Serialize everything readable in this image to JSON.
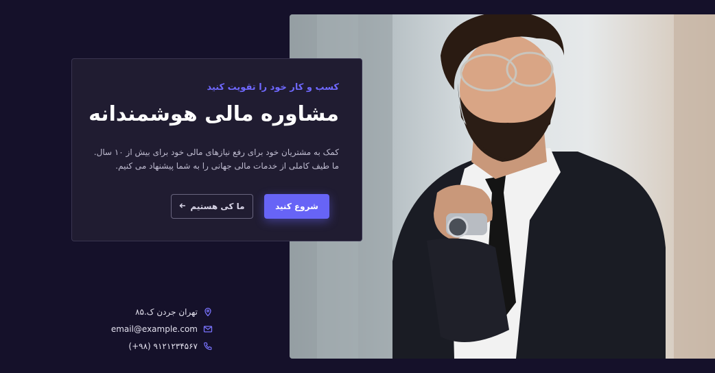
{
  "hero": {
    "eyebrow": "کسب و کار خود را تقویت کنید",
    "title": "مشاوره مالی هوشمندانه",
    "description_line1": "کمک به مشتریان خود برای رفع نیازهای مالی خود برای بیش از ۱۰ سال.",
    "description_line2": "ما طیف کاملی از خدمات مالی جهانی را به شما پیشنهاد می کنیم.",
    "primary_button": "شروع کنید",
    "secondary_button": "ما کی هستیم",
    "accent_color": "#6764f6"
  },
  "contact": {
    "address": "تهران جردن ک.۸۵",
    "email": "email@example.com",
    "phone": "(+۹۸) ۹۱۲۱۲۳۴۵۶۷"
  },
  "icons": {
    "address": "map-pin-icon",
    "email": "mail-icon",
    "phone": "phone-icon",
    "secondary_button": "arrow-left-icon"
  }
}
